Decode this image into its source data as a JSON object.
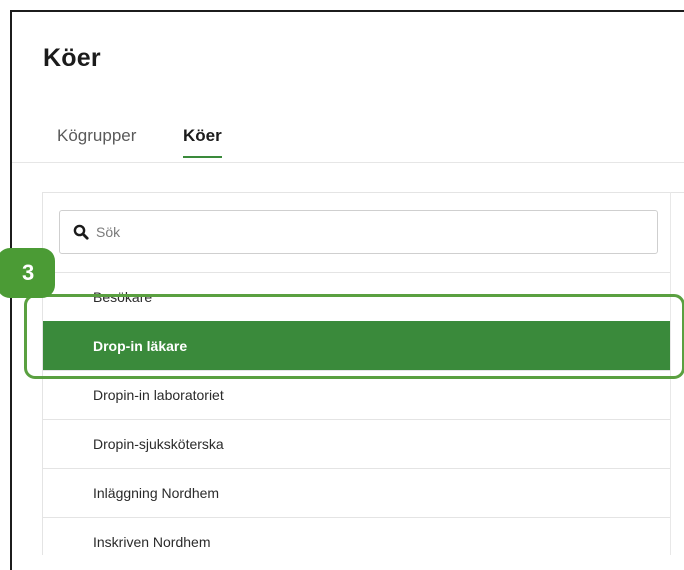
{
  "page": {
    "title": "Köer"
  },
  "tabs": [
    {
      "label": "Kögrupper",
      "active": false
    },
    {
      "label": "Köer",
      "active": true
    }
  ],
  "search": {
    "placeholder": "Sök",
    "value": "",
    "icon": "search-icon"
  },
  "queues": [
    {
      "label": "Besökare",
      "selected": false
    },
    {
      "label": "Drop-in läkare",
      "selected": true
    },
    {
      "label": "Dropin-in laboratoriet",
      "selected": false
    },
    {
      "label": "Dropin-sjuksköterska",
      "selected": false
    },
    {
      "label": "Inläggning Nordhem",
      "selected": false
    },
    {
      "label": "Inskriven Nordhem",
      "selected": false
    }
  ],
  "annotation": {
    "step_number": "3"
  },
  "colors": {
    "accent_green": "#3a8a3b",
    "highlight_green": "#5aa040",
    "badge_green": "#4b9b35"
  }
}
